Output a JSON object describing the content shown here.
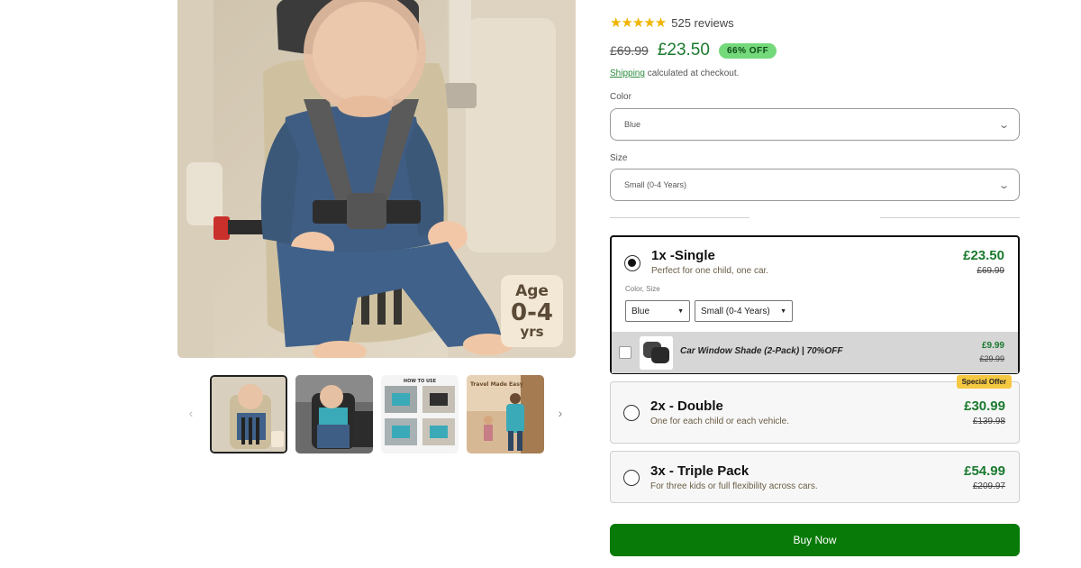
{
  "gallery": {
    "age_badge": {
      "line1": "Age",
      "line2": "0-4",
      "line3": "yrs"
    },
    "thumbnail_count": 4,
    "active_thumbnail": 1,
    "thumb3_heading": "HOW TO USE",
    "thumb4_text": "Travel Made Easy"
  },
  "product": {
    "rating": 5,
    "stars": "★★★★★",
    "reviews": "525 reviews",
    "compare_price": "£69.99",
    "price": "£23.50",
    "discount_badge": "66% OFF",
    "shipping_link": "Shipping",
    "shipping_text": " calculated at checkout."
  },
  "options": {
    "color_label": "Color",
    "color_value": "Blue",
    "size_label": "Size",
    "size_value": "Small (0-4 Years)"
  },
  "bundles": [
    {
      "title": "1x -Single",
      "subtitle": "Perfect for one child, one car.",
      "price": "£23.50",
      "compare": "£69.99",
      "selected": true,
      "variant_label": "Color, Size",
      "variant_color": "Blue",
      "variant_size": "Small (0-4 Years)",
      "addon": {
        "name": "Car Window Shade (2-Pack) | 70%OFF",
        "price": "£9.99",
        "compare": "£29.99",
        "checked": false
      }
    },
    {
      "title": "2x - Double",
      "subtitle": "One for each child or each vehicle.",
      "price": "£30.99",
      "compare": "£139.98",
      "badge": "Special Offer",
      "selected": false
    },
    {
      "title": "3x - Triple Pack",
      "subtitle": "For three kids or full flexibility across cars.",
      "price": "£54.99",
      "compare": "£209.97",
      "selected": false
    }
  ],
  "cta": {
    "label": "Buy Now"
  },
  "colors": {
    "price_green": "#1a7a2e",
    "cta_green": "#077a07",
    "badge_green": "#74d97a",
    "star_yellow": "#f0b400",
    "special_yellow": "#f5c842"
  }
}
